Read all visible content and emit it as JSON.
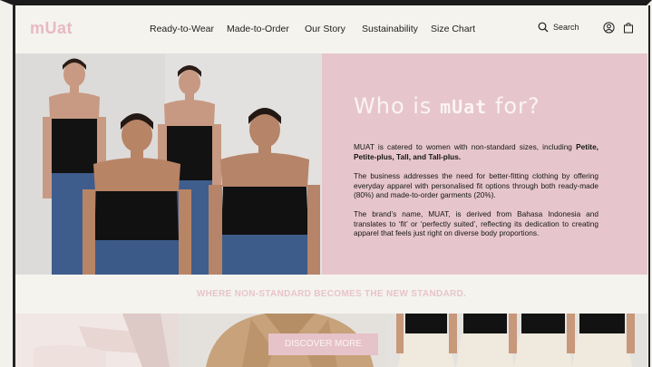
{
  "brand": {
    "logo_text": "mUat",
    "color": "#e8b8c3"
  },
  "nav": {
    "items": [
      {
        "label": "Ready-to-Wear"
      },
      {
        "label": "Made-to-Order"
      },
      {
        "label": "Our Story"
      },
      {
        "label": "Sustainability"
      },
      {
        "label": "Size Chart"
      }
    ],
    "search_label": "Search",
    "icons": [
      "search-icon",
      "account-icon",
      "bag-icon"
    ]
  },
  "hero": {
    "heading_pre": "Who is ",
    "heading_brand": "mUat",
    "heading_post": " for?",
    "p1_text": "MUAT is catered to women with non-standard sizes, including ",
    "p1_bold": "Petite, Petite-plus, Tall, and Tall-plus.",
    "p2": "The business addresses the need for better-fitting clothing by offering everyday apparel with personalised fit options through both ready-made (80%) and made-to-order garments (20%).",
    "p3": "The brand’s name, MUAT, is derived from Bahasa Indonesia and translates to ‘fit’ or ‘perfectly suited’, reflecting its dedication to creating apparel that feels just right on diverse body proportions.",
    "panel_color": "#e6c6cc"
  },
  "tagline": "WHERE NON-STANDARD BECOMES THE NEW STANDARD.",
  "cta": {
    "label": "DISCOVER MORE",
    "color": "#e6c2c9"
  }
}
